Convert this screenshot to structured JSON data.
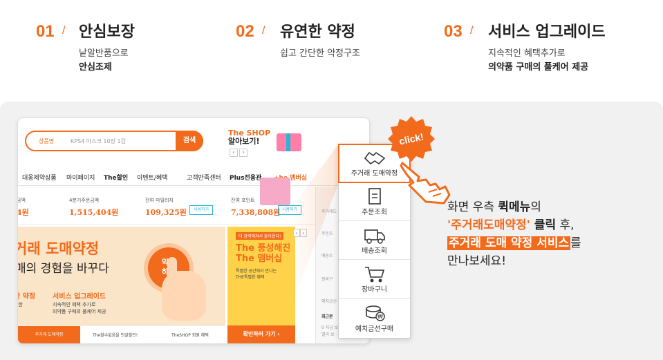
{
  "features": [
    {
      "num": "01",
      "slash": "/",
      "title": "안심보장",
      "desc1": "낱알반품으로",
      "desc2": "안심조제"
    },
    {
      "num": "02",
      "slash": "/",
      "title": "유연한 약정",
      "desc1": "쉽고 간단한 약정구조",
      "desc2": ""
    },
    {
      "num": "03",
      "slash": "/",
      "title": "서비스 업그레이드",
      "desc1": "지속적인 혜택추가로",
      "desc2": "의약품 구매의 풀케어 제공"
    }
  ],
  "screenshot": {
    "search": {
      "category": "상품명",
      "placeholder": "KPS4 마스크 10장 1갑",
      "button": "검색"
    },
    "promo": {
      "line1": "The SHOP",
      "line2": "알아보기!",
      "prev": "‹",
      "next": "›"
    },
    "nav": [
      "대웅제약상품",
      "마이페이지",
      "The할인",
      "이벤트/혜택",
      "고객만족센터",
      "Plus전용관",
      "+he 멤버십"
    ],
    "stats": [
      {
        "label": "금액",
        "value": "4원",
        "button": ""
      },
      {
        "label": "4분기주문금액",
        "value": "1,515,404원",
        "button": ""
      },
      {
        "label": "잔여 마일리지",
        "value": "109,325원",
        "button": "사용하기"
      },
      {
        "label": "잔여 포인트",
        "value": "7,338,808원",
        "button": "사용하기"
      }
    ],
    "banner": {
      "title": "거래 도매약정",
      "subtitle": "매의 경험을 바꾸다",
      "circle_line1": "약정",
      "circle_line2": "하기",
      "f1_title": "한 약정",
      "f1_desc": "단한",
      "f2_title": "서비스 업그레이드",
      "f2_desc1": "지속적인 혜택 추가로",
      "f2_desc2": "의약품 구매의 풀케어 제공"
    },
    "tabs": [
      "주거래 도매약정",
      "The할수없음을 인갈할인!",
      "TheSHOP 회원 혜택"
    ],
    "side_banner": {
      "tag": "더 강력해져서 돌아왔다!",
      "title1": "The 풍성해진",
      "title2": "The 멤버십",
      "desc1": "특별한 공간에서 만나는",
      "desc2": "THE특별한 혜택",
      "button": "확인하러 가기 ›",
      "prev": "‹",
      "next": "›"
    },
    "faded_quick": [
      "주거래도",
      "주문조",
      "배송조",
      "장바구",
      "예치금선",
      "최근본",
      "0 지금 보",
      "별리 보"
    ]
  },
  "quick_menu": [
    {
      "label": "주거래 도매약정",
      "icon": "handshake-icon"
    },
    {
      "label": "주문조회",
      "icon": "receipt-icon"
    },
    {
      "label": "배송조회",
      "icon": "truck-icon"
    },
    {
      "label": "장바구니",
      "icon": "cart-icon"
    },
    {
      "label": "예치금선구매",
      "icon": "coin-icon"
    }
  ],
  "click_badge": "click!",
  "message": {
    "line1_pre": "화면 우측 ",
    "line1_bold": "퀵메뉴",
    "line1_post": "의",
    "line2_orange": "'주거래도매약정'",
    "line2_bold": " 클릭",
    "line2_post": " 후,",
    "line3_highlight": "주거래 도매 약정 서비스",
    "line3_post": "를",
    "line4": "만나보세요!"
  },
  "colors": {
    "accent": "#f26a1b",
    "background": "#f1f1f1",
    "teal": "#27b6d9"
  }
}
